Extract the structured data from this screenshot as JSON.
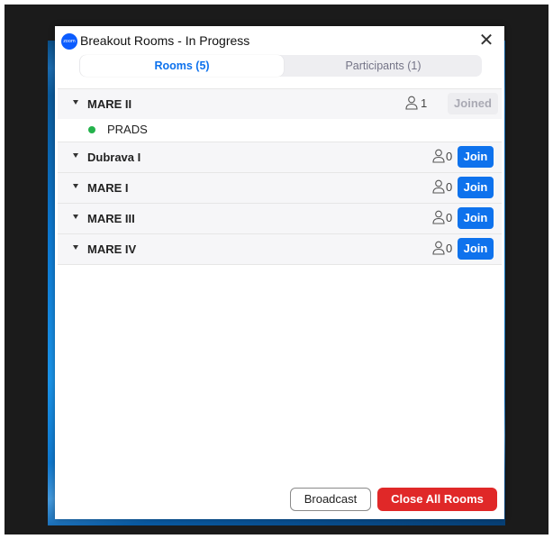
{
  "window": {
    "logo_text": "zoom",
    "title": "Breakout Rooms - In Progress",
    "close_glyph": "✕"
  },
  "tabs": [
    {
      "label": "Rooms (5)",
      "active": true
    },
    {
      "label": "Participants (1)",
      "active": false
    }
  ],
  "rooms": [
    {
      "name": "MARE II",
      "count": "1",
      "action": "Joined",
      "joined": true,
      "participants": [
        {
          "name": "PRADS",
          "status_color": "#24b24b"
        }
      ]
    },
    {
      "name": "Dubrava I",
      "count": "0",
      "action": "Join",
      "joined": false,
      "participants": []
    },
    {
      "name": "MARE I",
      "count": "0",
      "action": "Join",
      "joined": false,
      "participants": []
    },
    {
      "name": "MARE III",
      "count": "0",
      "action": "Join",
      "joined": false,
      "participants": []
    },
    {
      "name": "MARE IV",
      "count": "0",
      "action": "Join",
      "joined": false,
      "participants": []
    }
  ],
  "footer": {
    "broadcast_label": "Broadcast",
    "close_all_label": "Close All Rooms"
  },
  "colors": {
    "accent": "#0e72ed",
    "danger": "#e02828",
    "online": "#24b24b"
  },
  "icons": {
    "caret": "caret-down-icon",
    "person": "person-icon",
    "logo": "zoom-logo-icon",
    "close": "close-icon"
  }
}
